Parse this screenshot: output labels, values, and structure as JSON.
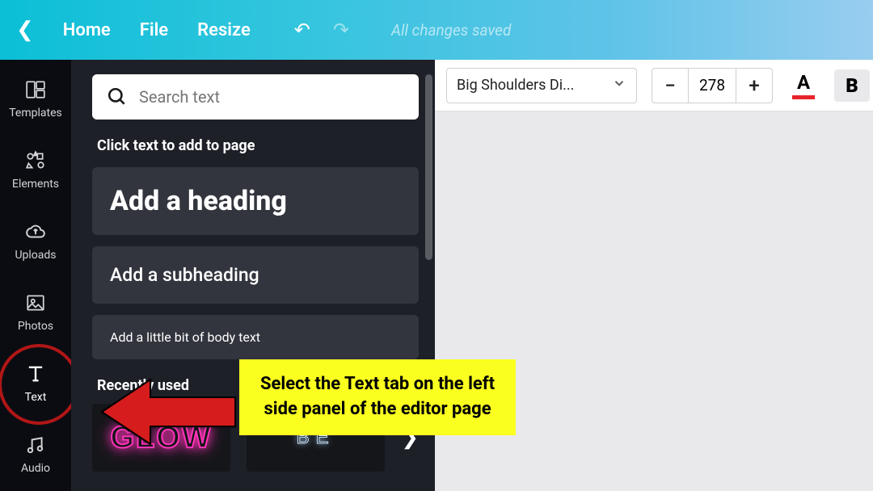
{
  "topbar": {
    "home": "Home",
    "file": "File",
    "resize": "Resize",
    "save_status": "All changes saved"
  },
  "rail": {
    "items": [
      {
        "label": "Templates"
      },
      {
        "label": "Elements"
      },
      {
        "label": "Uploads"
      },
      {
        "label": "Photos"
      },
      {
        "label": "Text"
      },
      {
        "label": "Audio"
      }
    ]
  },
  "panel": {
    "search_placeholder": "Search text",
    "instruction": "Click text to add to page",
    "heading": "Add a heading",
    "subheading": "Add a subheading",
    "body": "Add a little bit of body text",
    "recent_label": "Recently used",
    "templates": [
      {
        "text": "GLOW"
      },
      {
        "text": "BE"
      }
    ]
  },
  "propbar": {
    "font": "Big Shoulders Di...",
    "size": "278"
  },
  "callout": {
    "line1": "Select the Text tab on the left",
    "line2": "side panel of the editor page"
  }
}
